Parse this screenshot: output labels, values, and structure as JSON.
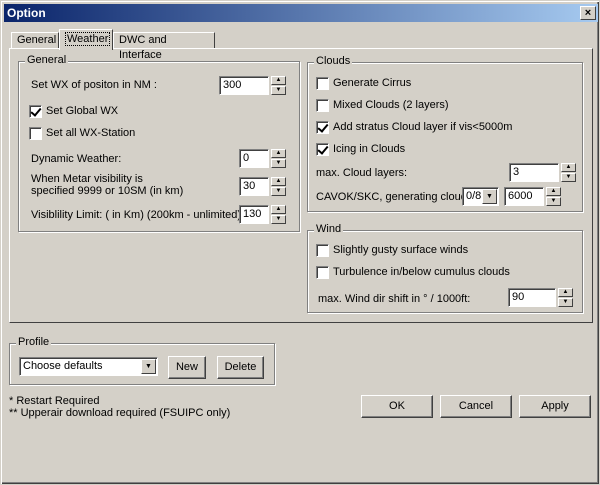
{
  "window": {
    "title": "Option",
    "close_glyph": "×"
  },
  "tabs": [
    "General",
    "Weather",
    "DWC and Interface"
  ],
  "general": {
    "title": "General",
    "wx_position_label": "Set WX of positon in NM :",
    "wx_position_value": "300",
    "set_global_wx": {
      "label": "Set Global WX",
      "checked": true
    },
    "set_all_stations": {
      "label": "Set all WX-Station",
      "checked": false
    },
    "dynamic_weather_label": "Dynamic Weather:",
    "dynamic_weather_value": "0",
    "metar_label_line1": "When Metar visibility is",
    "metar_label_line2": "specified 9999 or 10SM (in km)",
    "metar_value": "30",
    "vis_limit_label": "Visiblility Limit: ( in Km) (200km - unlimited)",
    "vis_limit_value": "130"
  },
  "clouds": {
    "title": "Clouds",
    "generate_cirrus": {
      "label": "Generate Cirrus",
      "checked": false
    },
    "mixed_clouds": {
      "label": "Mixed Clouds (2 layers)",
      "checked": false
    },
    "add_stratus": {
      "label": "Add stratus Cloud layer if vis<5000m",
      "checked": true
    },
    "icing": {
      "label": "Icing in Clouds",
      "checked": true
    },
    "max_layers_label": "max. Cloud layers:",
    "max_layers_value": "3",
    "cavok_label": "CAVOK/SKC, generating clouds",
    "cavok_select": "0/8",
    "cavok_value": "6000"
  },
  "wind": {
    "title": "Wind",
    "gusty": {
      "label": "Slightly gusty surface winds",
      "checked": false
    },
    "turbulence": {
      "label": "Turbulence in/below cumulus clouds",
      "checked": false
    },
    "max_shift_label": "max. Wind dir shift in ° / 1000ft:",
    "max_shift_value": "90"
  },
  "profile": {
    "title": "Profile",
    "select_value": "Choose defaults",
    "new_label": "New",
    "delete_label": "Delete"
  },
  "notes": {
    "restart": "*  Restart Required",
    "upperair": "** Upperair download required (FSUIPC only)"
  },
  "buttons": {
    "ok": "OK",
    "cancel": "Cancel",
    "apply": "Apply"
  },
  "icons": {
    "spin_up": "▲",
    "spin_down": "▼",
    "dropdown": "▼"
  }
}
